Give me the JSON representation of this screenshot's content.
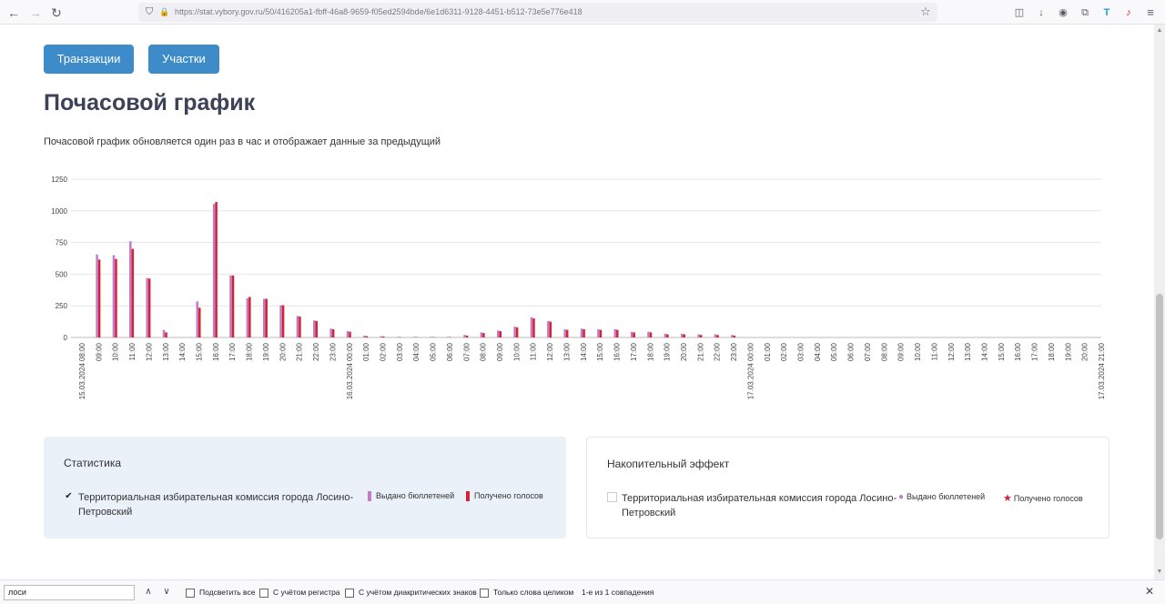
{
  "browser": {
    "url": "https://stat.vybory.gov.ru/50/416205a1-fbff-46a8-9659-f05ed2594bde/6e1d6311-9128-4451-b512-73e5e776e418"
  },
  "actions": {
    "transactions_label": "Транзакции",
    "participants_label": "Участки"
  },
  "page": {
    "title": "Почасовой график",
    "subtitle": "Почасовой график обновляется один раз в час и отображает данные за предыдущий"
  },
  "colors": {
    "issued": "#c27ac9",
    "received": "#d42434",
    "button": "#3d8bc9"
  },
  "chart_data": {
    "type": "bar",
    "ylim": [
      0,
      1250
    ],
    "yticks": [
      "1250",
      "1000",
      "750",
      "500",
      "250",
      "0"
    ],
    "categories": [
      "15.03.2024 08:00",
      "09:00",
      "10:00",
      "11:00",
      "12:00",
      "13:00",
      "14:00",
      "15:00",
      "16:00",
      "17:00",
      "18:00",
      "19:00",
      "20:00",
      "21:00",
      "22:00",
      "23:00",
      "16.03.2024 00:00",
      "01:00",
      "02:00",
      "03:00",
      "04:00",
      "05:00",
      "06:00",
      "07:00",
      "08:00",
      "09:00",
      "10:00",
      "11:00",
      "12:00",
      "13:00",
      "14:00",
      "15:00",
      "16:00",
      "17:00",
      "18:00",
      "19:00",
      "20:00",
      "21:00",
      "22:00",
      "23:00",
      "17.03.2024 00:00",
      "01:00",
      "02:00",
      "03:00",
      "04:00",
      "05:00",
      "06:00",
      "07:00",
      "08:00",
      "09:00",
      "10:00",
      "11:00",
      "12:00",
      "13:00",
      "14:00",
      "15:00",
      "16:00",
      "17:00",
      "18:00",
      "19:00",
      "20:00",
      "17.03.2024 21:00"
    ],
    "series": [
      {
        "name": "Выдано бюллетеней",
        "values": [
          0,
          655,
          650,
          760,
          470,
          60,
          0,
          285,
          1055,
          490,
          310,
          305,
          255,
          170,
          135,
          70,
          50,
          15,
          10,
          5,
          5,
          5,
          5,
          20,
          40,
          55,
          85,
          160,
          130,
          65,
          70,
          65,
          65,
          45,
          45,
          30,
          30,
          25,
          25,
          20,
          0,
          0,
          0,
          0,
          0,
          0,
          0,
          0,
          0,
          0,
          0,
          0,
          0,
          0,
          0,
          0,
          0,
          0,
          0,
          0,
          0,
          0
        ]
      },
      {
        "name": "Получено голосов",
        "values": [
          0,
          615,
          620,
          700,
          465,
          40,
          0,
          235,
          1070,
          490,
          320,
          305,
          255,
          165,
          130,
          65,
          45,
          10,
          8,
          3,
          3,
          3,
          3,
          15,
          35,
          50,
          80,
          150,
          125,
          60,
          65,
          60,
          60,
          40,
          40,
          25,
          25,
          20,
          20,
          15,
          0,
          0,
          0,
          0,
          0,
          0,
          0,
          0,
          0,
          0,
          0,
          0,
          0,
          0,
          0,
          0,
          0,
          0,
          0,
          0,
          0,
          0
        ]
      }
    ]
  },
  "stats_panel": {
    "title": "Статистика",
    "entity": "Территориальная избирательная комиссия города Лосино-Петровский",
    "checkmark": "✔",
    "legend_issued": "Выдано бюллетеней",
    "legend_received": "Получено голосов"
  },
  "cumulative_panel": {
    "title": "Накопительный эффект",
    "entity": "Территориальная избирательная комиссия города Лосино-Петровский",
    "legend_issued": "Выдано бюллетеней",
    "legend_received": "Получено голосов",
    "marker_issued": "●",
    "marker_received": "★"
  },
  "find_bar": {
    "query": "лоси",
    "prev_glyph": "∧",
    "next_glyph": "∨",
    "highlight_all": "Подсветить все",
    "match_case": "С учётом регистра",
    "diacritics": "С учётом диакритических знаков",
    "whole_words": "Только слова целиком",
    "status": "1-е из 1 совпадения",
    "close_glyph": "✕"
  },
  "icons": {
    "back": "←",
    "forward": "→",
    "reload": "↻",
    "shield": "⛉",
    "lock": "🔒",
    "star": "☆",
    "pocket": "◫",
    "download": "↓",
    "account": "◉",
    "extensions": "⧉",
    "translate": "T",
    "music": "♪",
    "menu": "≡"
  }
}
